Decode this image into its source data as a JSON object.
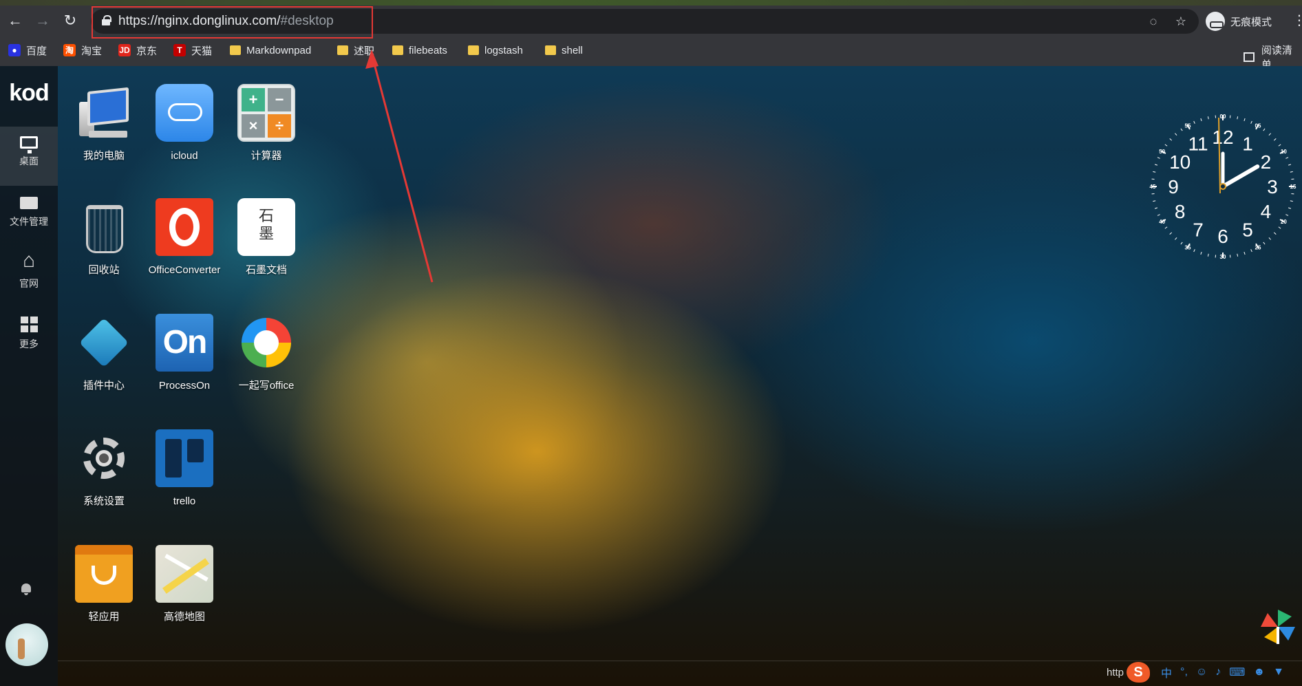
{
  "browser": {
    "url_main": "https://nginx.donglinux.com/",
    "url_hash": "#desktop",
    "incognito_label": "无痕模式",
    "reading_list_label": "阅读清单"
  },
  "bookmarks": [
    {
      "label": "百度",
      "icon": "baidu-icon",
      "color": "#2932e1"
    },
    {
      "label": "淘宝",
      "icon": "taobao-icon",
      "color": "#ff5000"
    },
    {
      "label": "京东",
      "icon": "jd-icon",
      "color": "#e1251b"
    },
    {
      "label": "天猫",
      "icon": "tmall-icon",
      "color": "#c40000"
    },
    {
      "label": "Markdownpad",
      "icon": "folder-icon"
    },
    {
      "label": "述职",
      "icon": "folder-icon"
    },
    {
      "label": "filebeats",
      "icon": "folder-icon"
    },
    {
      "label": "logstash",
      "icon": "folder-icon"
    },
    {
      "label": "shell",
      "icon": "folder-icon"
    }
  ],
  "sidebar": {
    "logo": "kod",
    "items": [
      {
        "label": "桌面",
        "icon": "monitor-icon",
        "active": true
      },
      {
        "label": "文件管理",
        "icon": "folder-icon"
      },
      {
        "label": "官网",
        "icon": "home-icon"
      },
      {
        "label": "更多",
        "icon": "grid-icon"
      }
    ]
  },
  "desktop_apps": [
    {
      "label": "我的电脑",
      "icon": "computer-icon"
    },
    {
      "label": "icloud",
      "icon": "icloud-icon"
    },
    {
      "label": "计算器",
      "icon": "calculator-icon"
    },
    {
      "label": "回收站",
      "icon": "trash-icon"
    },
    {
      "label": "OfficeConverter",
      "icon": "office-converter-icon"
    },
    {
      "label": "石墨文档",
      "icon": "shimo-icon",
      "icon_text": "石\n墨"
    },
    {
      "label": "插件中心",
      "icon": "plugin-icon"
    },
    {
      "label": "ProcessOn",
      "icon": "processon-icon",
      "icon_text": "On"
    },
    {
      "label": "一起写office",
      "icon": "yiqixie-icon"
    },
    {
      "label": "系统设置",
      "icon": "settings-icon"
    },
    {
      "label": "trello",
      "icon": "trello-icon"
    },
    {
      "label": "轻应用",
      "icon": "light-app-icon"
    },
    {
      "label": "高德地图",
      "icon": "amap-icon"
    }
  ],
  "calculator_keys": [
    "+",
    "−",
    "×",
    "÷"
  ],
  "clock": {
    "hour_numbers": [
      "12",
      "1",
      "2",
      "3",
      "4",
      "5",
      "6",
      "7",
      "8",
      "9",
      "10",
      "11"
    ],
    "minute_numbers": [
      "00",
      "05",
      "10",
      "15",
      "20",
      "25",
      "30",
      "35",
      "40",
      "45",
      "50",
      "55"
    ],
    "hour": 2,
    "minute": 0
  },
  "tray": {
    "text": "http",
    "ime_label": "中",
    "ime_brand": "S"
  },
  "colors": {
    "annotation_red": "#e53935",
    "chrome_bg": "#35363a"
  }
}
